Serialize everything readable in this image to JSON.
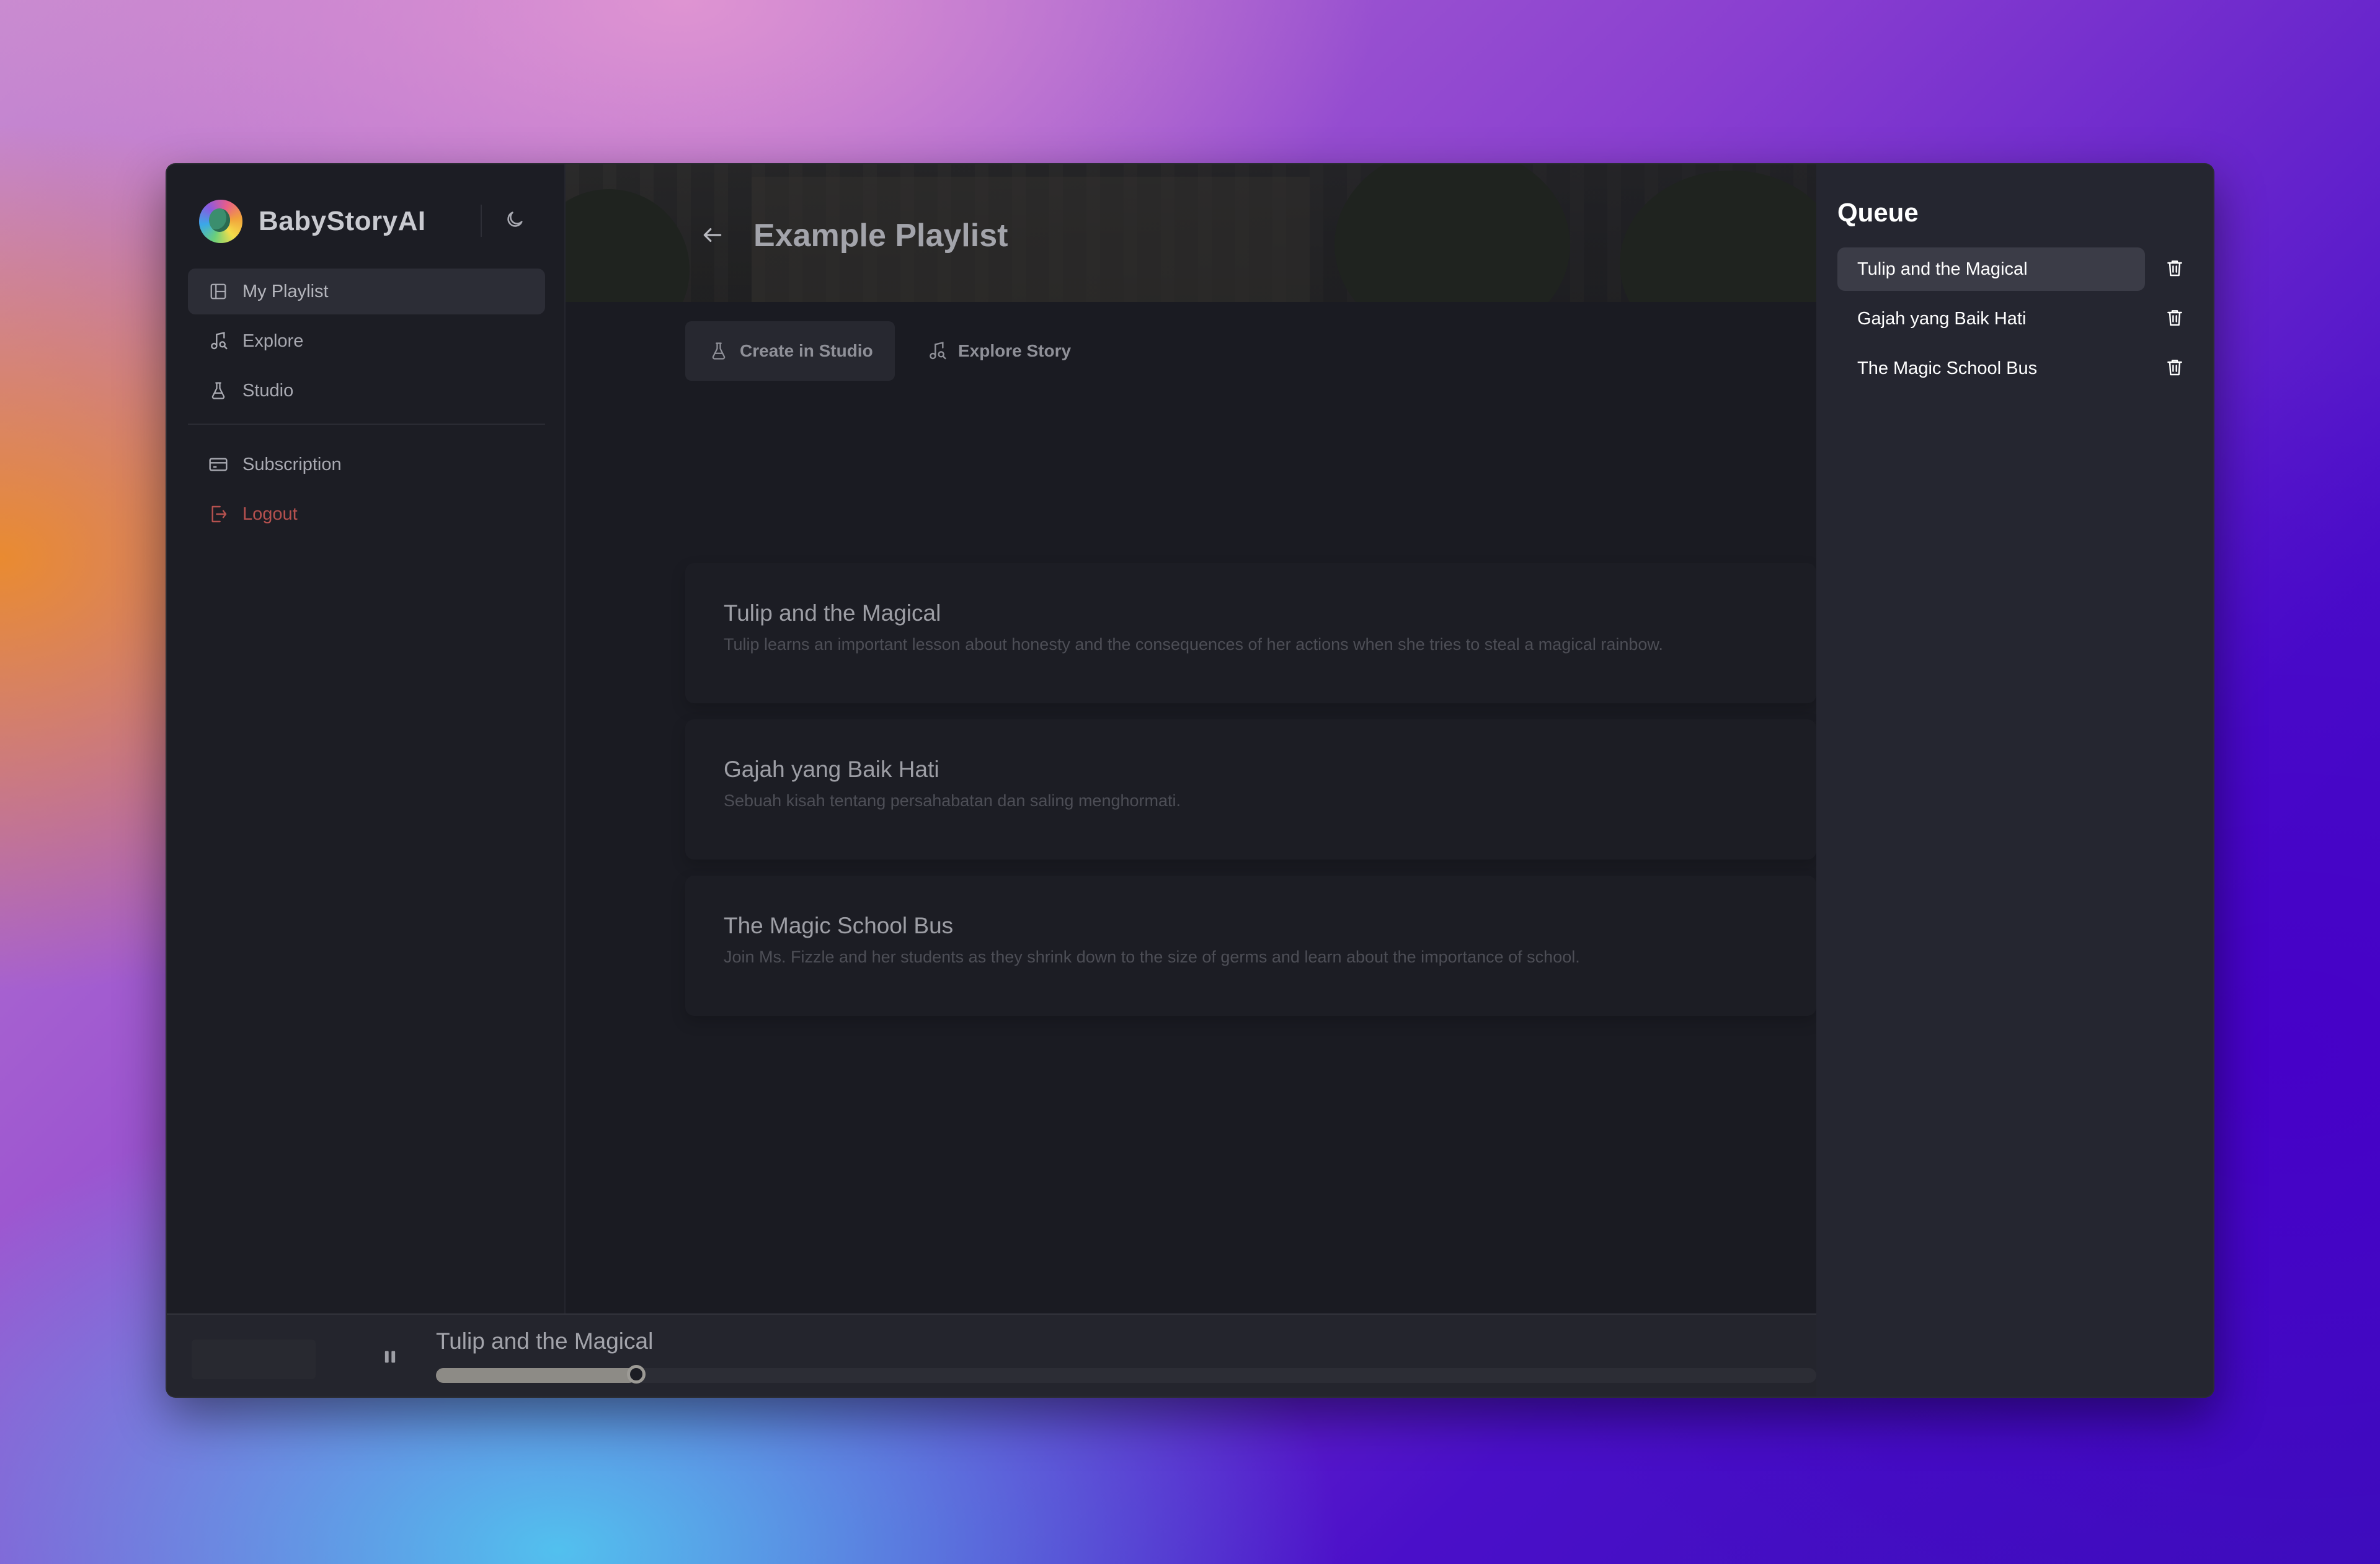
{
  "brand": {
    "name": "BabyStoryAI",
    "logo_icon": "dragon-logo-icon",
    "theme_icon": "moon-icon"
  },
  "sidebar": {
    "items": [
      {
        "label": "My Playlist",
        "icon": "playlist-icon",
        "active": true
      },
      {
        "label": "Explore",
        "icon": "music-search-icon"
      },
      {
        "label": "Studio",
        "icon": "flask-icon"
      },
      {
        "label": "Subscription",
        "icon": "credit-card-icon"
      },
      {
        "label": "Logout",
        "icon": "logout-icon",
        "color": "#b5514f"
      }
    ]
  },
  "header": {
    "title": "Example Playlist",
    "back_icon": "arrow-left-icon"
  },
  "actions": {
    "create": {
      "label": "Create in Studio",
      "icon": "flask-icon"
    },
    "explore": {
      "label": "Explore Story",
      "icon": "music-search-icon"
    }
  },
  "stories": [
    {
      "title": "Tulip and the Magical",
      "description": "Tulip learns an important lesson about honesty and the consequences of her actions when she tries to steal a magical rainbow."
    },
    {
      "title": "Gajah yang Baik Hati",
      "description": "Sebuah kisah tentang persahabatan dan saling menghormati."
    },
    {
      "title": "The Magic School Bus",
      "description": "Join Ms. Fizzle and her students as they shrink down to the size of germs and learn about the importance of school."
    }
  ],
  "player": {
    "title": "Tulip and the Magical",
    "state_icon": "pause-icon",
    "progress": 0.145
  },
  "queue": {
    "title": "Queue",
    "items": [
      {
        "title": "Tulip and the Magical",
        "active": true
      },
      {
        "title": "Gajah yang Baik Hati"
      },
      {
        "title": "The Magic School Bus"
      }
    ],
    "remove_icon": "trash-icon"
  },
  "colors": {
    "accent_danger": "#b5514f",
    "background": "#1a1b22",
    "queue_panel": "#252630"
  }
}
